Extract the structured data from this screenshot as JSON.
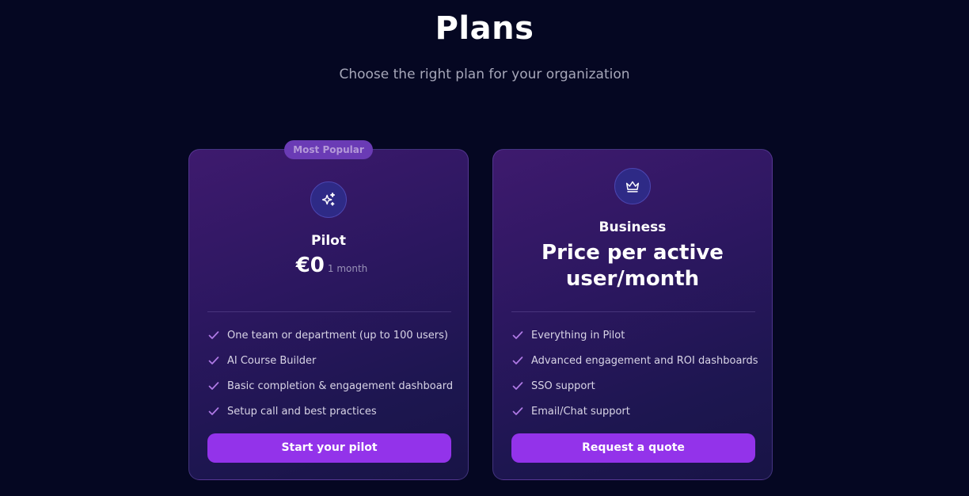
{
  "header": {
    "title": "Plans",
    "subtitle": "Choose the right plan for your organization"
  },
  "plans": [
    {
      "badge": "Most Popular",
      "icon": "sparkles-icon",
      "name": "Pilot",
      "price": "€0",
      "period": "1 month",
      "features": [
        "One team or department (up to 100 users)",
        "AI Course Builder",
        "Basic completion & engagement dashboard",
        "Setup call and best practices"
      ],
      "cta": "Start your pilot"
    },
    {
      "icon": "crown-icon",
      "name": "Business",
      "price_line1": "Price per active",
      "price_line2": "user/month",
      "features": [
        "Everything in Pilot",
        "Advanced engagement and ROI dashboards",
        "SSO support",
        "Email/Chat support"
      ],
      "cta": "Request a quote"
    }
  ],
  "colors": {
    "background": "#050722",
    "accent": "#9333ea",
    "check": "#b07ae6",
    "icon_circle": "#2e2a86"
  }
}
